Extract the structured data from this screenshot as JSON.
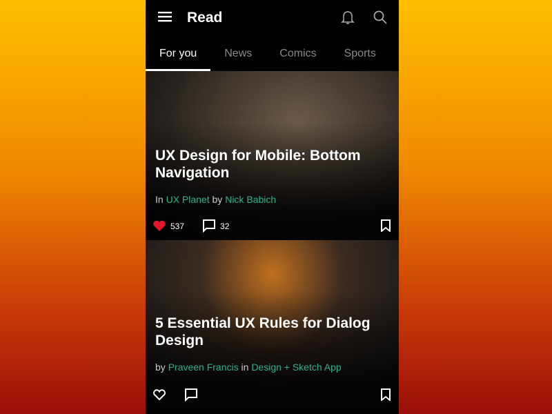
{
  "app": {
    "title": "Read"
  },
  "tabs": [
    {
      "label": "For you"
    },
    {
      "label": "News"
    },
    {
      "label": "Comics"
    },
    {
      "label": "Sports"
    }
  ],
  "articles": [
    {
      "title": "UX Design for Mobile: Bottom Navigation",
      "prefix": "In",
      "publication": "UX Planet",
      "by": "by",
      "author": "Nick Babich",
      "likes": "537",
      "comments": "32",
      "liked": true
    },
    {
      "title": "5 Essential UX Rules for Dialog Design",
      "prefix": "by",
      "author": "Praveen Francis",
      "in": "in",
      "publication": "Design + Sketch App",
      "liked": false
    }
  ],
  "colors": {
    "accent": "#2db38f",
    "like": "#e0182d"
  }
}
